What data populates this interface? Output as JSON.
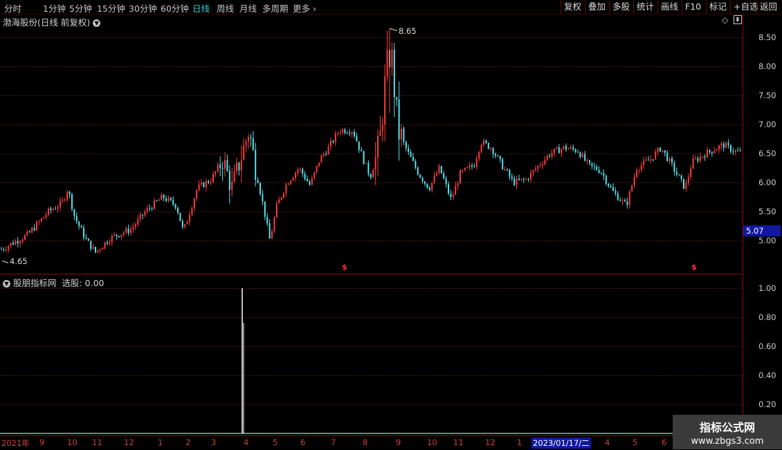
{
  "toolbar": {
    "periods": [
      "分时",
      "1分钟",
      "5分钟",
      "15分钟",
      "30分钟",
      "60分钟",
      "日线",
      "周线",
      "月线",
      "多周期",
      "更多"
    ],
    "active_period": "日线",
    "buttons": [
      "复权",
      "叠加",
      "多股",
      "统计",
      "画线",
      "F10",
      "标记",
      "+自选",
      "返回"
    ]
  },
  "main_pane": {
    "title": "渤海股份(日线 前复权)",
    "current_price": "5.07",
    "high_label": "8.65",
    "low_label": "4.65",
    "yticks": [
      "8.50",
      "8.00",
      "7.50",
      "7.00",
      "6.50",
      "6.00",
      "5.50",
      "5.00"
    ]
  },
  "indicator_pane": {
    "title": "股朋指标网",
    "value_label": "选股: 0.00",
    "yticks": [
      "1.00",
      "0.80",
      "0.60",
      "0.40",
      "0.20"
    ]
  },
  "xaxis": {
    "labels": [
      "2021年",
      "9",
      "10",
      "11",
      "12",
      "1",
      "2",
      "3",
      "4",
      "5",
      "6",
      "7",
      "8",
      "9",
      "10",
      "11",
      "12",
      "1",
      "2023/01/17/二",
      "4",
      "5",
      "6"
    ]
  },
  "colors": {
    "up": "#ff3c3c",
    "down": "#54e6f0",
    "accent": "#36d0d0",
    "grid": "#5a1a1a"
  },
  "watermark": {
    "line1": "指标公式网",
    "line2": "www.zbgs3.com"
  },
  "chart_data": {
    "type": "candlestick",
    "price_range": [
      4.6,
      8.7
    ],
    "high": 8.65,
    "low": 4.65,
    "last": 5.07,
    "signal_series": {
      "name": "选股",
      "range": [
        0,
        1.0
      ],
      "spike_value": 1.0
    }
  }
}
